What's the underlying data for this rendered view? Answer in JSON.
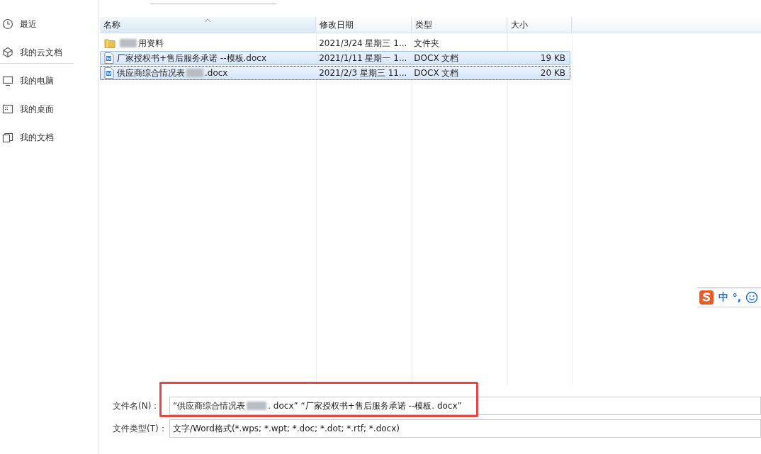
{
  "sidebar": {
    "groups": [
      [
        {
          "label": "最近"
        },
        {
          "label": "我的云文档"
        }
      ],
      [
        {
          "label": "我的电脑"
        },
        {
          "label": "我的桌面"
        },
        {
          "label": "我的文档"
        }
      ]
    ]
  },
  "table": {
    "columns": [
      "名称",
      "修改日期",
      "类型",
      "大小"
    ],
    "rows": [
      {
        "kind": "folder",
        "name_before": "",
        "name_after": "用资料",
        "blurred": true,
        "date": "2021/3/24 星期三 1...",
        "type": "文件夹",
        "size": "",
        "selected": false,
        "focused": false
      },
      {
        "kind": "docx",
        "name_before": "厂家授权书+售后服务承诺 --模板.docx",
        "name_after": "",
        "blurred": false,
        "date": "2021/1/11 星期一 1...",
        "type": "DOCX 文档",
        "size": "19 KB",
        "selected": true,
        "focused": false
      },
      {
        "kind": "docx",
        "name_before": "供应商综合情况表",
        "name_after": ".docx",
        "blurred": true,
        "date": "2021/2/3 星期三 11...",
        "type": "DOCX 文档",
        "size": "20 KB",
        "selected": true,
        "focused": true
      }
    ]
  },
  "ime": {
    "lang": "中",
    "punct": "°,"
  },
  "form": {
    "filename_label": "文件名(N)：",
    "filename_before": "“供应商综合情况表",
    "filename_after": ". docx” “厂家授权书+售后服务承诺 --模板. docx”",
    "filetype_label": "文件类型(T)：",
    "filetype": "文字/Word格式(*.wps; *.wpt; *.doc; *.dot; *.rtf; *.docx)",
    "highlighted": true
  }
}
